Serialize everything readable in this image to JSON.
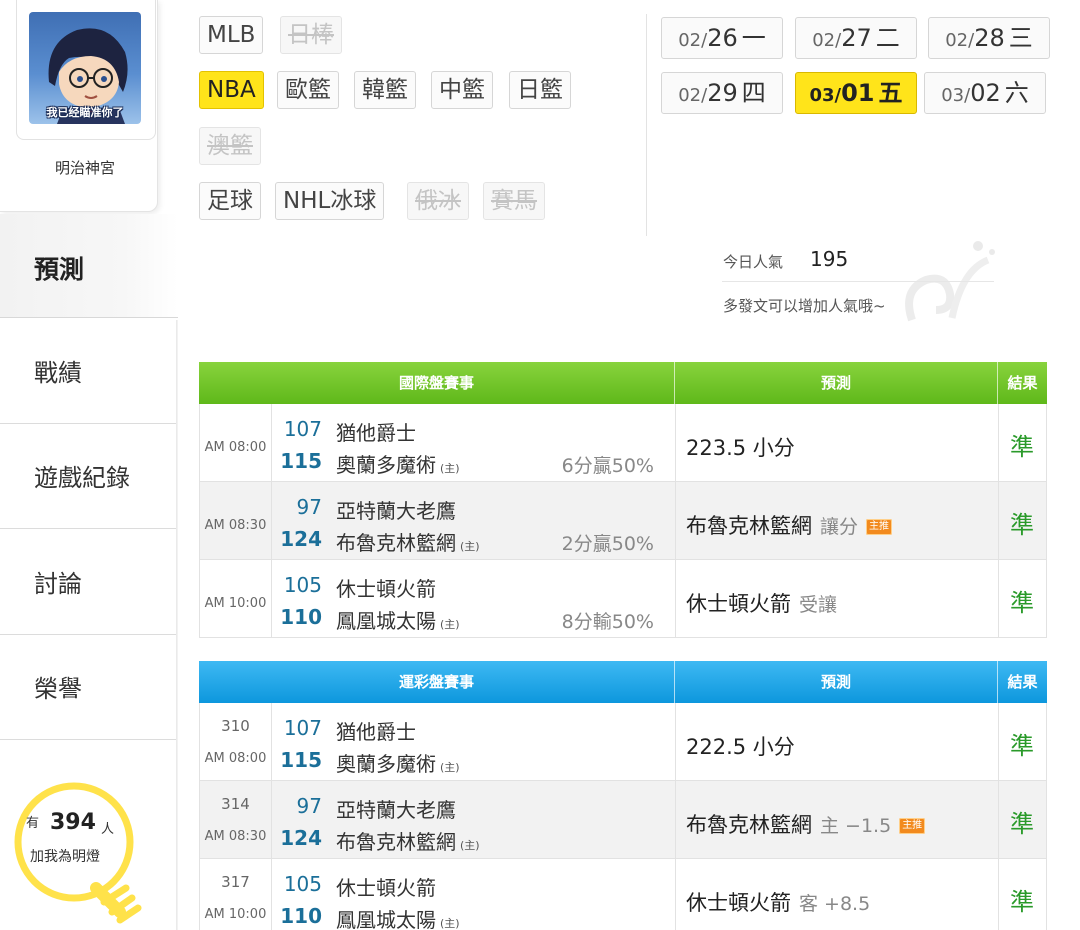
{
  "profile": {
    "avatar_caption": "我已经瞄准你了",
    "username": "明治神宮"
  },
  "nav": {
    "active": "預測",
    "items": [
      "戰績",
      "遊戲紀錄",
      "討論",
      "榮譽"
    ]
  },
  "bulb": {
    "prefix": "有",
    "count": "394",
    "unit": "人",
    "suffix": "加我為明燈"
  },
  "categories": [
    {
      "label": "MLB",
      "state": "normal"
    },
    {
      "label": "日棒",
      "state": "disabled"
    },
    {
      "label": "NBA",
      "state": "active"
    },
    {
      "label": "歐籃",
      "state": "normal"
    },
    {
      "label": "韓籃",
      "state": "normal"
    },
    {
      "label": "中籃",
      "state": "normal"
    },
    {
      "label": "日籃",
      "state": "normal"
    },
    {
      "label": "澳籃",
      "state": "disabled"
    },
    {
      "label": "足球",
      "state": "normal"
    },
    {
      "label": "NHL冰球",
      "state": "normal"
    },
    {
      "label": "俄冰",
      "state": "disabled"
    },
    {
      "label": "賽馬",
      "state": "disabled"
    }
  ],
  "dates": [
    {
      "month": "02/",
      "day": "26",
      "weekday": "一",
      "active": false
    },
    {
      "month": "02/",
      "day": "27",
      "weekday": "二",
      "active": false
    },
    {
      "month": "02/",
      "day": "28",
      "weekday": "三",
      "active": false
    },
    {
      "month": "02/",
      "day": "29",
      "weekday": "四",
      "active": false
    },
    {
      "month": "03/",
      "day": "01",
      "weekday": "五",
      "active": true
    },
    {
      "month": "03/",
      "day": "02",
      "weekday": "六",
      "active": false
    }
  ],
  "popularity": {
    "label": "今日人氣",
    "value": "195",
    "hint": "多發文可以增加人氣哦~"
  },
  "international": {
    "headers": {
      "event": "國際盤賽事",
      "prediction": "預測",
      "result": "結果"
    },
    "rows": [
      {
        "time": "AM 08:00",
        "away_score": "107",
        "away_team": "猶他爵士",
        "home_score": "115",
        "home_team": "奧蘭多魔術",
        "home_mark": "(主)",
        "spread": "6分贏50%",
        "prediction": "223.5 小分",
        "note": "",
        "badge": "",
        "result": "準"
      },
      {
        "time": "AM 08:30",
        "away_score": "97",
        "away_team": "亞特蘭大老鷹",
        "home_score": "124",
        "home_team": "布魯克林籃網",
        "home_mark": "(主)",
        "spread": "2分贏50%",
        "prediction": "布魯克林籃網",
        "note": "讓分",
        "badge": "主推",
        "result": "準"
      },
      {
        "time": "AM 10:00",
        "away_score": "105",
        "away_team": "休士頓火箭",
        "home_score": "110",
        "home_team": "鳳凰城太陽",
        "home_mark": "(主)",
        "spread": "8分輸50%",
        "prediction": "休士頓火箭",
        "note": "受讓",
        "badge": "",
        "result": "準"
      }
    ]
  },
  "sports_lottery": {
    "headers": {
      "event": "運彩盤賽事",
      "prediction": "預測",
      "result": "結果"
    },
    "rows": [
      {
        "code": "310",
        "time": "AM 08:00",
        "away_score": "107",
        "away_team": "猶他爵士",
        "home_score": "115",
        "home_team": "奧蘭多魔術",
        "home_mark": "(主)",
        "prediction": "222.5 小分",
        "note": "",
        "badge": "",
        "result": "準"
      },
      {
        "code": "314",
        "time": "AM 08:30",
        "away_score": "97",
        "away_team": "亞特蘭大老鷹",
        "home_score": "124",
        "home_team": "布魯克林籃網",
        "home_mark": "(主)",
        "prediction": "布魯克林籃網",
        "note": "主 −1.5",
        "badge": "主推",
        "result": "準"
      },
      {
        "code": "317",
        "time": "AM 10:00",
        "away_score": "105",
        "away_team": "休士頓火箭",
        "home_score": "110",
        "home_team": "鳳凰城太陽",
        "home_mark": "(主)",
        "prediction": "休士頓火箭",
        "note": "客 +8.5",
        "badge": "",
        "result": "準"
      }
    ]
  },
  "colors": {
    "active_yellow": "#ffe41a",
    "intl_header_green": "#6cc126",
    "lottery_header_blue": "#1ea6e8",
    "result_green": "#2a9a2a",
    "score_blue": "#1b6f99",
    "badge_orange": "#f28a1e"
  }
}
